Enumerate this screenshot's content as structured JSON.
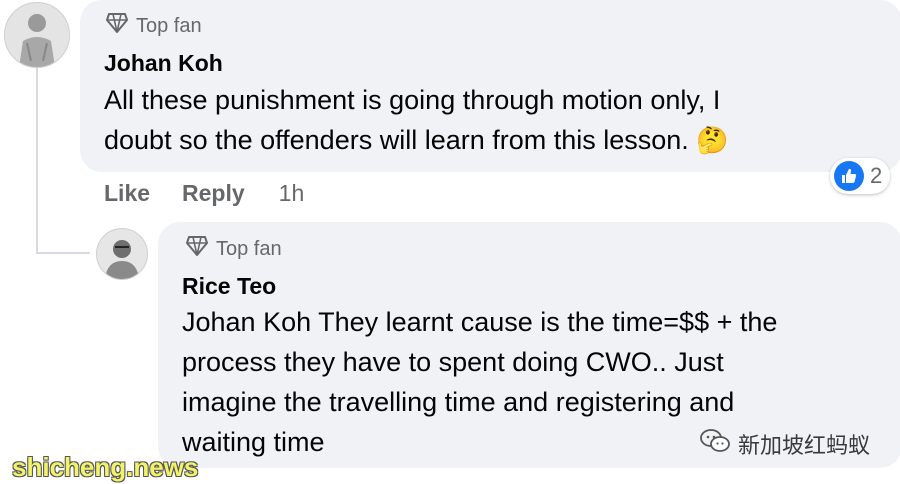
{
  "comment": {
    "badge": "Top fan",
    "author": "Johan Koh",
    "lines": [
      "All these punishment is going through motion only, I",
      "doubt so the offenders will learn from this lesson."
    ],
    "emoji": "🤔",
    "actions": {
      "like": "Like",
      "reply": "Reply",
      "time": "1h"
    },
    "reaction": {
      "icon": "thumbs-up-icon",
      "count": "2",
      "color": "#1877f2"
    }
  },
  "reply": {
    "badge": "Top fan",
    "author": "Rice Teo",
    "lines": [
      "Johan Koh They learnt cause is the time=$$ + the",
      "process they have to spent doing CWO.. Just",
      "imagine the travelling time and registering and",
      "waiting time"
    ]
  },
  "watermarks": {
    "left": "shicheng.news",
    "right": "新加坡红蚂蚁"
  },
  "colors": {
    "bubble": "#f0f2f5",
    "muted_text": "#65676b",
    "watermark_left": "#f3f36a"
  }
}
